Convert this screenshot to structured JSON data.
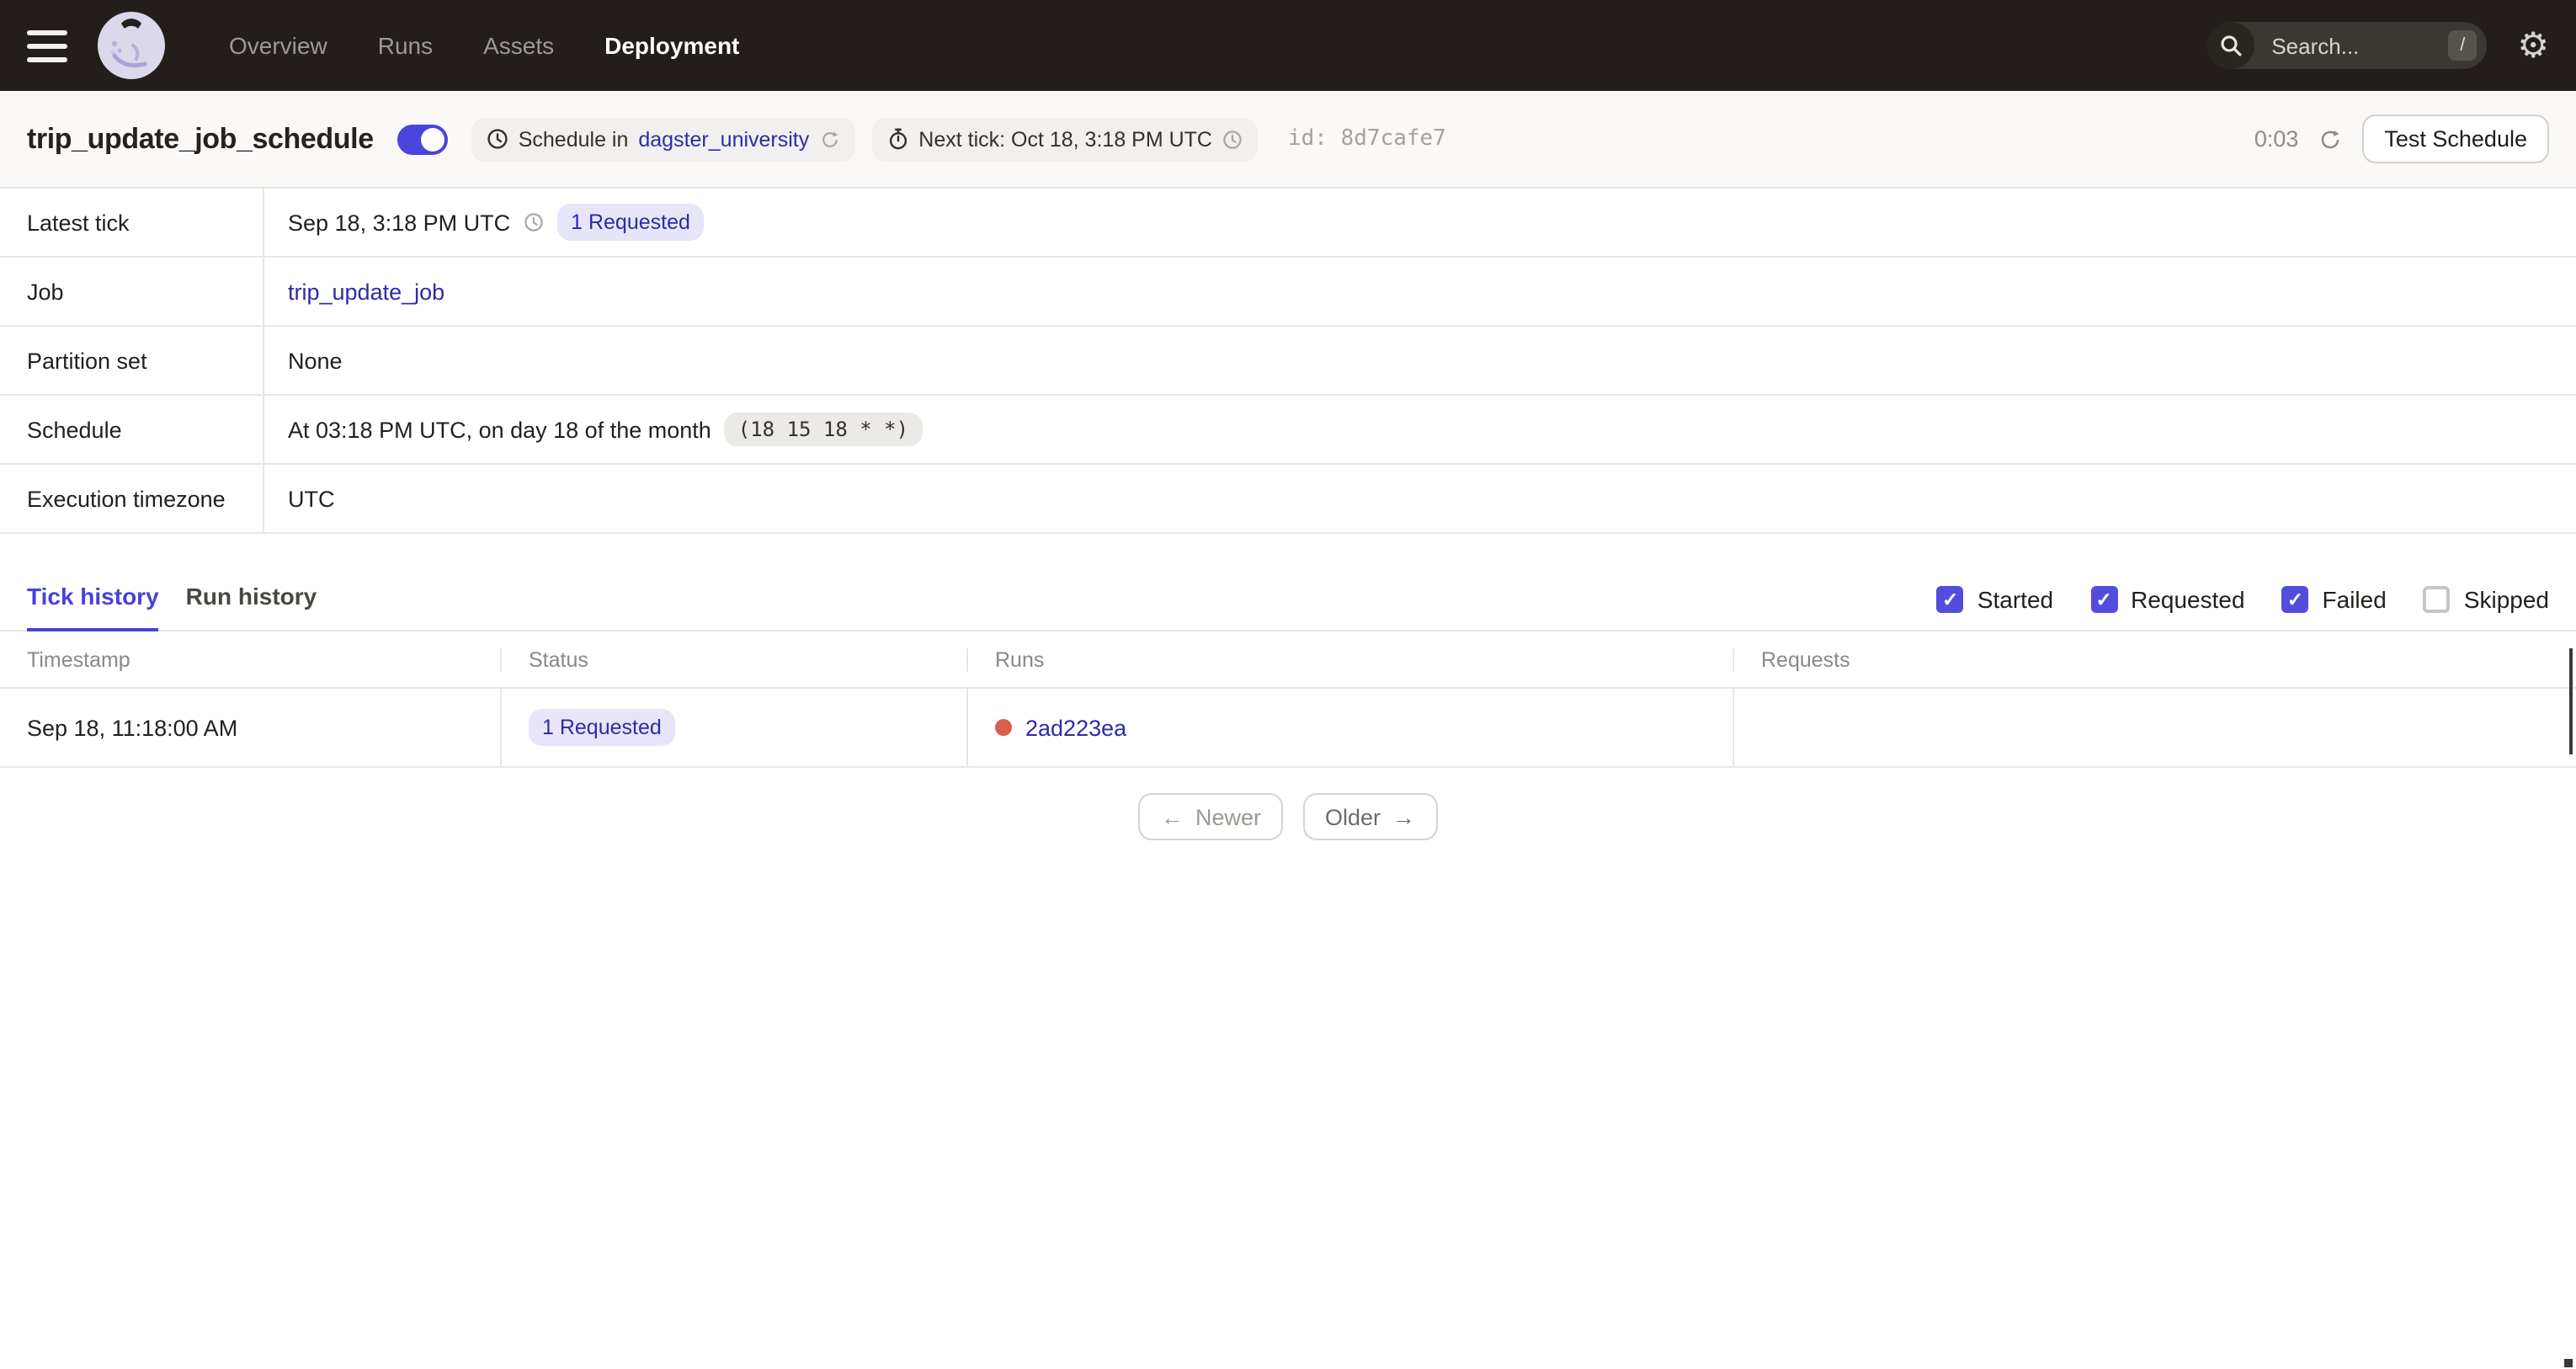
{
  "nav": {
    "items": [
      {
        "label": "Overview",
        "active": false
      },
      {
        "label": "Runs",
        "active": false
      },
      {
        "label": "Assets",
        "active": false
      },
      {
        "label": "Deployment",
        "active": true
      }
    ],
    "search": {
      "placeholder": "Search...",
      "shortcut": "/"
    }
  },
  "header": {
    "title": "trip_update_job_schedule",
    "toggle_on": true,
    "schedule_pill": {
      "prefix": "Schedule in",
      "link": "dagster_university"
    },
    "next_tick_pill": "Next tick: Oct 18, 3:18 PM UTC",
    "id_text": "id: 8d7cafe7",
    "countdown": "0:03",
    "test_schedule_label": "Test Schedule"
  },
  "details": {
    "latest_tick": {
      "label": "Latest tick",
      "time": "Sep 18, 3:18 PM UTC",
      "badge": "1 Requested"
    },
    "job": {
      "label": "Job",
      "link": "trip_update_job"
    },
    "partition_set": {
      "label": "Partition set",
      "value": "None"
    },
    "schedule": {
      "label": "Schedule",
      "text": "At 03:18 PM UTC, on day 18 of the month",
      "cron": "(18 15 18 * *)"
    },
    "timezone": {
      "label": "Execution timezone",
      "value": "UTC"
    }
  },
  "tabs": [
    {
      "label": "Tick history",
      "active": true
    },
    {
      "label": "Run history",
      "active": false
    }
  ],
  "filters": [
    {
      "label": "Started",
      "checked": true
    },
    {
      "label": "Requested",
      "checked": true
    },
    {
      "label": "Failed",
      "checked": true
    },
    {
      "label": "Skipped",
      "checked": false
    }
  ],
  "table": {
    "columns": [
      "Timestamp",
      "Status",
      "Runs",
      "Requests"
    ],
    "rows": [
      {
        "timestamp": "Sep 18, 11:18:00 AM",
        "status": "1 Requested",
        "run_id": "2ad223ea",
        "run_status": "failed"
      }
    ]
  },
  "pagination": {
    "newer_arrow": "←",
    "newer": "Newer",
    "older": "Older",
    "older_arrow": "→"
  },
  "colors": {
    "accent": "#4A43DC",
    "link": "#2D2BA8",
    "badge_bg": "#E7E5F8",
    "run_failed_dot": "#D95E4E",
    "nav_bg": "#231E1B"
  }
}
